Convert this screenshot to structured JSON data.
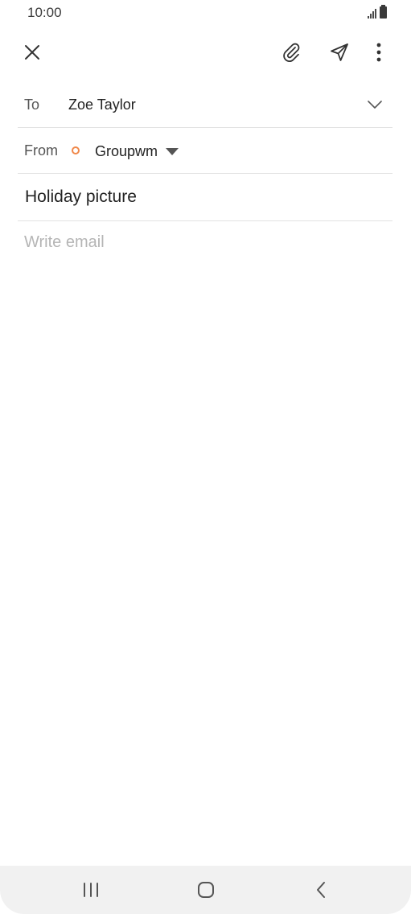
{
  "status_bar": {
    "time": "10:00",
    "icons": [
      "signal-icon",
      "battery-icon"
    ]
  },
  "toolbar": {
    "close_icon": "close-icon",
    "attach_icon": "paperclip-icon",
    "send_icon": "send-icon",
    "more_icon": "more-vertical-icon"
  },
  "compose": {
    "to_label": "To",
    "to_value": "Zoe Taylor",
    "from_label": "From",
    "from_value": "Groupwm",
    "from_dot_color": "#f0884a",
    "subject": "Holiday picture",
    "body_placeholder": "Write email"
  },
  "nav_bar": {
    "recents_icon": "recents-icon",
    "home_icon": "home-icon",
    "back_icon": "back-icon"
  }
}
